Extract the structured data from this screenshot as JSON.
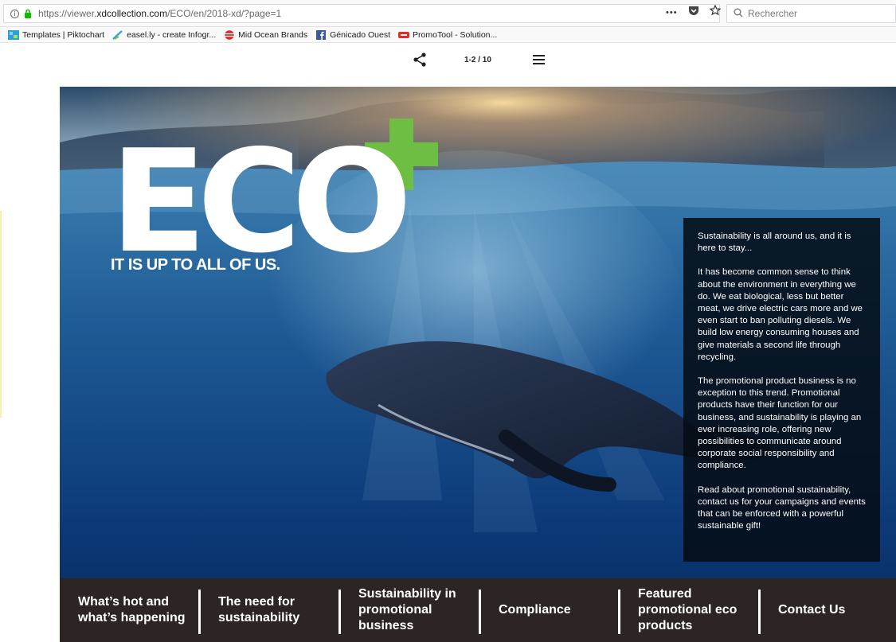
{
  "browser": {
    "url_prefix": "https://viewer.",
    "url_domain": "xdcollection.com",
    "url_path": "/ECO/en/2018-xd/?page=1",
    "overflow_label": "•••",
    "search_placeholder": "Rechercher"
  },
  "bookmarks": [
    {
      "label": "Templates | Piktochart",
      "icon": "piktochart-icon"
    },
    {
      "label": "easel.ly - create Infogr...",
      "icon": "easelly-icon"
    },
    {
      "label": "Mid Ocean Brands",
      "icon": "midocean-icon"
    },
    {
      "label": "Génicado Ouest",
      "icon": "facebook-icon"
    },
    {
      "label": "PromoTool - Solution...",
      "icon": "promotool-icon"
    }
  ],
  "viewer": {
    "page_indicator": "1-2 / 10"
  },
  "cover": {
    "logo_text": "ECO",
    "tagline": "IT IS UP TO ALL OF US.",
    "accent_color": "#6ebe44",
    "paragraphs": [
      "Sustainability is all around us, and it is here to stay...",
      "It has become common sense to think about the environment in everything we do. We eat biological, less but better meat, we drive electric cars more and we even start to ban polluting diesels. We build low energy consuming houses and give materials a second life through recycling.",
      "The promotional product business is no exception to this trend. Promotional products have their function for our business, and sustainability is playing an ever increasing role, offering new possibilities to communicate around corporate social responsibility and compliance.",
      "Read about promotional sustainability, contact us for your campaigns and events that can be enforced with a powerful sustainable gift!"
    ]
  },
  "nav": [
    "What’s hot and what’s happening",
    "The need for sustainability",
    "Sustainability in promotional business",
    "Compliance",
    "Featured promotional eco products",
    "Contact Us"
  ]
}
